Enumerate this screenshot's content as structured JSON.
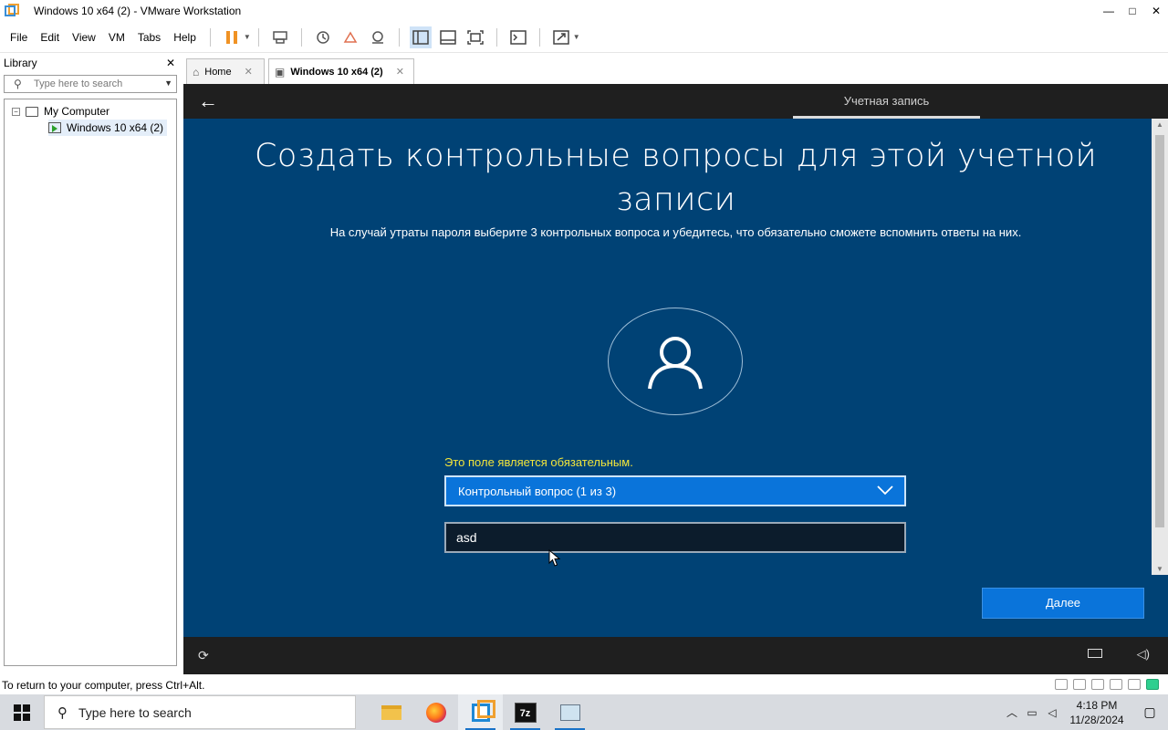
{
  "window": {
    "title": "Windows 10 x64 (2) - VMware Workstation",
    "minimize": "—",
    "maximize": "□",
    "close": "✕"
  },
  "menu": {
    "items": [
      "File",
      "Edit",
      "View",
      "VM",
      "Tabs",
      "Help"
    ]
  },
  "library": {
    "title": "Library",
    "close": "✕",
    "search_placeholder": "Type here to search",
    "tree": {
      "toggle": "−",
      "root": "My Computer",
      "child": "Windows 10 x64 (2)"
    }
  },
  "tabs": [
    {
      "label": "Home",
      "icon": "home-icon",
      "close": "✕"
    },
    {
      "label": "Windows 10 x64 (2)",
      "icon": "vm-icon",
      "close": "✕"
    }
  ],
  "vm_screen": {
    "back": "←",
    "top_tab": "Учетная запись",
    "heading_line1": "Создать контрольные вопросы для этой учетной",
    "heading_line2": "записи",
    "subtitle": "На случай утраты пароля выберите 3 контрольных вопроса и убедитесь, что обязательно сможете вспомнить ответы на них.",
    "required_message": "Это поле является обязательным.",
    "question_select": "Контрольный вопрос (1 из 3)",
    "answer_value": "asd",
    "next_button": "Далее",
    "accent_color": "#0a74da",
    "background_color": "#004275"
  },
  "statusbar": {
    "text": "To return to your computer, press Ctrl+Alt."
  },
  "taskbar": {
    "search_placeholder": "Type here to search",
    "apps": [
      "file-explorer-icon",
      "firefox-icon",
      "vmware-icon",
      "7zip-icon",
      "app-icon"
    ],
    "sevenzip_label": "7z",
    "time": "4:18 PM",
    "date": "11/28/2024"
  }
}
